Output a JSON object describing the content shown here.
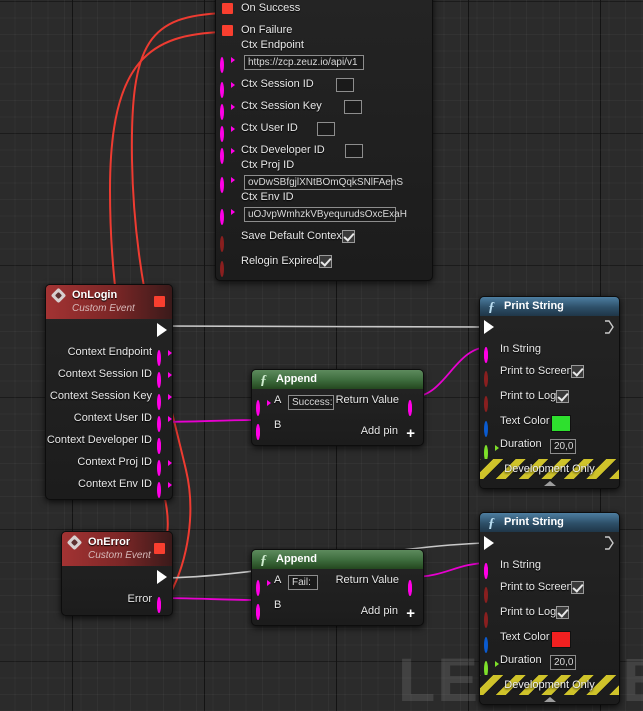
{
  "canvas": {
    "watermark": "LEVEL B",
    "background_color": "#2b2b2b",
    "grid_color": "#333333"
  },
  "nodes": {
    "detail_panel": {
      "exec_pins": [
        {
          "label": "On Success",
          "pin": "exec-square-red"
        },
        {
          "label": "On Failure",
          "pin": "exec-square-red"
        }
      ],
      "fields": [
        {
          "label": "Ctx Endpoint",
          "value": "https://zcp.zeuz.io/api/v1",
          "type": "string",
          "pin": "string-pin"
        },
        {
          "label": "Ctx Session ID",
          "value": "",
          "type": "string",
          "pin": "string-pin"
        },
        {
          "label": "Ctx Session Key",
          "value": "",
          "type": "string",
          "pin": "string-pin"
        },
        {
          "label": "Ctx User ID",
          "value": "",
          "type": "string",
          "pin": "string-pin"
        },
        {
          "label": "Ctx Developer ID",
          "value": "",
          "type": "string",
          "pin": "string-pin"
        },
        {
          "label": "Ctx Proj ID",
          "value": "ovDwSBfgjlXNtBOmQqkSNlFAenS",
          "type": "string",
          "pin": "string-pin"
        },
        {
          "label": "Ctx Env ID",
          "value": "uOJvpWmhzkVByequrudsOxcExaH",
          "type": "string",
          "pin": "string-pin"
        }
      ],
      "checkboxes": [
        {
          "label": "Save Default Context",
          "checked": true,
          "pin": "bool-pin"
        },
        {
          "label": "Relogin Expired",
          "checked": true,
          "pin": "bool-pin"
        }
      ]
    },
    "onlogin": {
      "title": "OnLogin",
      "subtitle": "Custom Event",
      "outputs": [
        "Context Endpoint",
        "Context Session ID",
        "Context Session Key",
        "Context User ID",
        "Context Developer ID",
        "Context Proj ID",
        "Context Env ID"
      ]
    },
    "onerror": {
      "title": "OnError",
      "subtitle": "Custom Event",
      "outputs": [
        "Error"
      ]
    },
    "append1": {
      "title": "Append",
      "input_a_label": "A",
      "input_a_value": "Success:",
      "input_b_label": "B",
      "output_label": "Return Value",
      "add_pin_label": "Add pin"
    },
    "append2": {
      "title": "Append",
      "input_a_label": "A",
      "input_a_value": "Fail:",
      "input_b_label": "B",
      "output_label": "Return Value",
      "add_pin_label": "Add pin"
    },
    "print1": {
      "title": "Print String",
      "in_string_label": "In String",
      "print_to_screen_label": "Print to Screen",
      "print_to_screen_checked": true,
      "print_to_log_label": "Print to Log",
      "print_to_log_checked": true,
      "text_color_label": "Text Color",
      "text_color_value": "#2ee02e",
      "duration_label": "Duration",
      "duration_value": "20,0",
      "footer_label": "Development Only"
    },
    "print2": {
      "title": "Print String",
      "in_string_label": "In String",
      "print_to_screen_label": "Print to Screen",
      "print_to_screen_checked": true,
      "print_to_log_label": "Print to Log",
      "print_to_log_checked": true,
      "text_color_label": "Text Color",
      "text_color_value": "#f22020",
      "duration_label": "Duration",
      "duration_value": "20,0",
      "footer_label": "Development Only"
    }
  },
  "wire_colors": {
    "exec_red": "#ee3b31",
    "exec_white": "#c9c9c9",
    "string": "#e800d0"
  }
}
